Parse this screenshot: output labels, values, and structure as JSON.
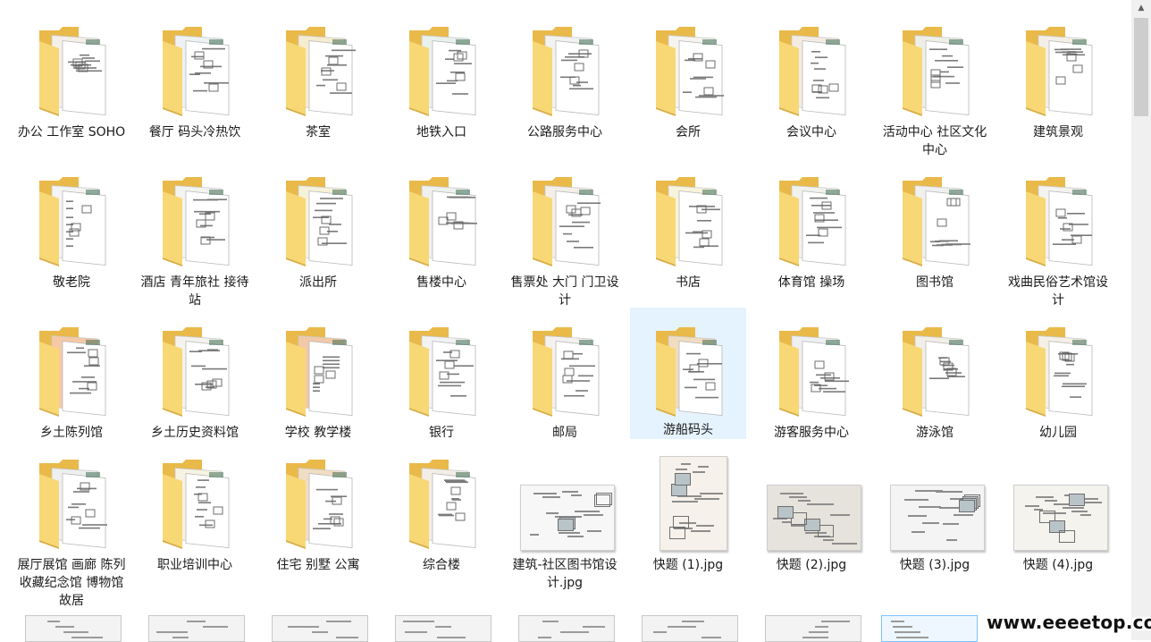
{
  "folders": [
    {
      "label": "办公 工作室 SOHO",
      "tint": "#f4f0e8"
    },
    {
      "label": "餐厅 码头冷热饮",
      "tint": "#eef2f4"
    },
    {
      "label": "茶室",
      "tint": "#f6ecd0"
    },
    {
      "label": "地铁入口",
      "tint": "#e9f1ec"
    },
    {
      "label": "公路服务中心",
      "tint": "#f2f2f0"
    },
    {
      "label": "会所",
      "tint": "#f6f4ee"
    },
    {
      "label": "会议中心",
      "tint": "#f4ece2"
    },
    {
      "label": "活动中心 社区文化中心",
      "tint": "#eef0e8"
    },
    {
      "label": "建筑景观",
      "tint": "#f3efe6"
    },
    {
      "label": "敬老院",
      "tint": "#f4f4f4"
    },
    {
      "label": "酒店 青年旅社 接待站",
      "tint": "#f3f3f0"
    },
    {
      "label": "派出所",
      "tint": "#f6f2da"
    },
    {
      "label": "售楼中心",
      "tint": "#eef1ee"
    },
    {
      "label": "售票处 大门 门卫设计",
      "tint": "#f3efe8"
    },
    {
      "label": "书店",
      "tint": "#f7f3dc"
    },
    {
      "label": "体育馆 操场",
      "tint": "#f1f1ee"
    },
    {
      "label": "图书馆",
      "tint": "#f0f0ee"
    },
    {
      "label": "戏曲民俗艺术馆设计",
      "tint": "#f4f3ef"
    },
    {
      "label": "乡土陈列馆",
      "tint": "#f6c9a6"
    },
    {
      "label": "乡土历史资料馆",
      "tint": "#f5f3ee"
    },
    {
      "label": "学校 教学楼",
      "tint": "#f2c9a8"
    },
    {
      "label": "银行",
      "tint": "#f3f3f3"
    },
    {
      "label": "邮局",
      "tint": "#f4f1ee"
    },
    {
      "label": "游船码头",
      "tint": "#f1dcc0"
    },
    {
      "label": "游客服务中心",
      "tint": "#eef0f2"
    },
    {
      "label": "游泳馆",
      "tint": "#f2efe8"
    },
    {
      "label": "幼儿园",
      "tint": "#f4f0e6"
    },
    {
      "label": "展厅展馆 画廊 陈列收藏纪念馆 博物馆 故居",
      "tint": "#eef0f0"
    },
    {
      "label": "职业培训中心",
      "tint": "#f6f3e2"
    },
    {
      "label": "住宅 别墅 公寓",
      "tint": "#f1ddc4"
    },
    {
      "label": "综合楼",
      "tint": "#f2eee6"
    }
  ],
  "images": [
    {
      "label": "建筑-社区图书馆设计.jpg",
      "orientation": "landscape",
      "paper": "#f7f7f7"
    },
    {
      "label": "快题 (1).jpg",
      "orientation": "portrait",
      "paper": "#f6f1ea"
    },
    {
      "label": "快题 (2).jpg",
      "orientation": "landscape",
      "paper": "#e6e3dc"
    },
    {
      "label": "快题 (3).jpg",
      "orientation": "landscape",
      "paper": "#f4f4f4"
    },
    {
      "label": "快题 (4).jpg",
      "orientation": "landscape",
      "paper": "#f5f3ee"
    }
  ],
  "selected_label": "游船码头",
  "watermark": "www.eeeetop.com",
  "colors": {
    "folder_back": "#e9b949",
    "folder_front": "#f8d775",
    "selection": "#e5f3ff"
  },
  "icons": {
    "folder": "folder-icon",
    "image": "image-thumbnail",
    "scroll_up": "chevron-up-icon"
  }
}
